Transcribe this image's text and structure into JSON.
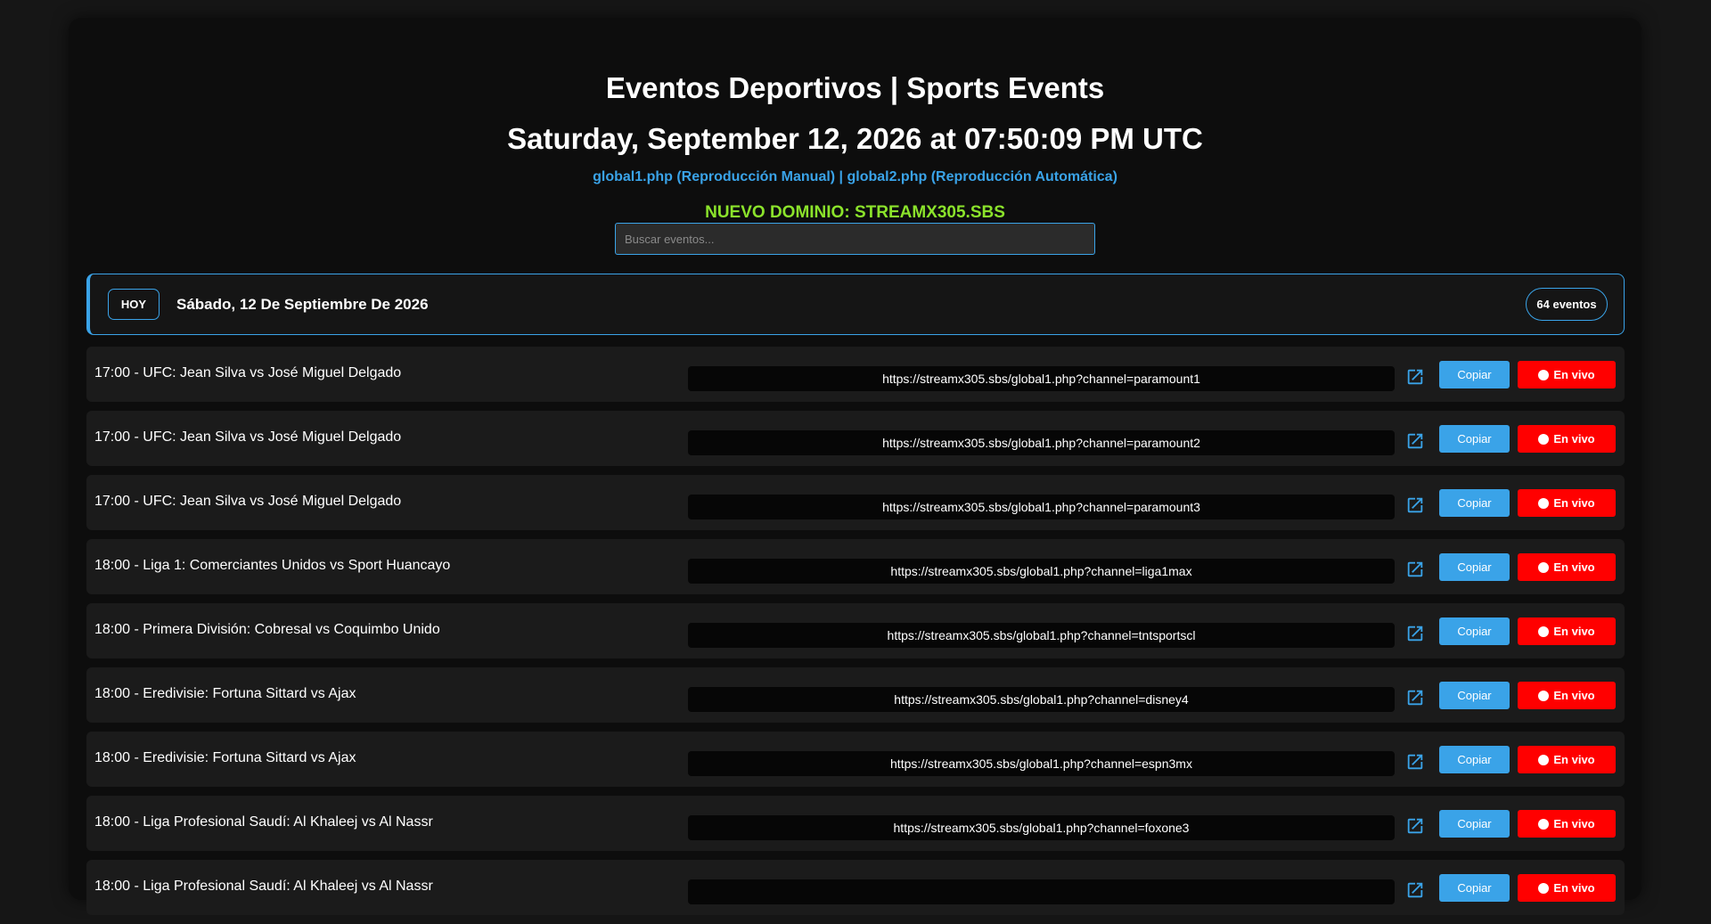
{
  "header": {
    "title": "Eventos Deportivos | Sports Events",
    "datetime": "Saturday, September 12, 2026 at 07:50:09 PM UTC",
    "links_text": "global1.php (Reproducción Manual) | global2.php (Reproducción Automática)",
    "domain_notice": "NUEVO DOMINIO: STREAMX305.SBS"
  },
  "search": {
    "placeholder": "Buscar eventos..."
  },
  "day": {
    "badge": "HOY",
    "label": "Sábado, 12 De Septiembre De 2026",
    "count": "64 eventos"
  },
  "events": [
    {
      "title": "17:00 - UFC: Jean Silva vs José Miguel Delgado",
      "url": "https://streamx305.sbs/global1.php?channel=paramount1",
      "copy": "Copiar",
      "live": "En vivo"
    },
    {
      "title": "17:00 - UFC: Jean Silva vs José Miguel Delgado",
      "url": "https://streamx305.sbs/global1.php?channel=paramount2",
      "copy": "Copiar",
      "live": "En vivo"
    },
    {
      "title": "17:00 - UFC: Jean Silva vs José Miguel Delgado",
      "url": "https://streamx305.sbs/global1.php?channel=paramount3",
      "copy": "Copiar",
      "live": "En vivo"
    },
    {
      "title": "18:00 - Liga 1: Comerciantes Unidos vs Sport Huancayo",
      "url": "https://streamx305.sbs/global1.php?channel=liga1max",
      "copy": "Copiar",
      "live": "En vivo"
    },
    {
      "title": "18:00 - Primera División: Cobresal vs Coquimbo Unido",
      "url": "https://streamx305.sbs/global1.php?channel=tntsportscl",
      "copy": "Copiar",
      "live": "En vivo"
    },
    {
      "title": "18:00 - Eredivisie: Fortuna Sittard vs Ajax",
      "url": "https://streamx305.sbs/global1.php?channel=disney4",
      "copy": "Copiar",
      "live": "En vivo"
    },
    {
      "title": "18:00 - Eredivisie: Fortuna Sittard vs Ajax",
      "url": "https://streamx305.sbs/global1.php?channel=espn3mx",
      "copy": "Copiar",
      "live": "En vivo"
    },
    {
      "title": "18:00 - Liga Profesional Saudí: Al Khaleej vs Al Nassr",
      "url": "https://streamx305.sbs/global1.php?channel=foxone3",
      "copy": "Copiar",
      "live": "En vivo"
    },
    {
      "title": "18:00 - Liga Profesional Saudí: Al Khaleej vs Al Nassr",
      "url": "",
      "copy": "Copiar",
      "live": "En vivo"
    }
  ],
  "icons": {
    "open": "external-link-icon",
    "live": "live-dot-icon"
  },
  "colors": {
    "accent": "#3aa3e8",
    "live": "#ff0000",
    "notice": "#8be32b",
    "background": "#161616"
  }
}
